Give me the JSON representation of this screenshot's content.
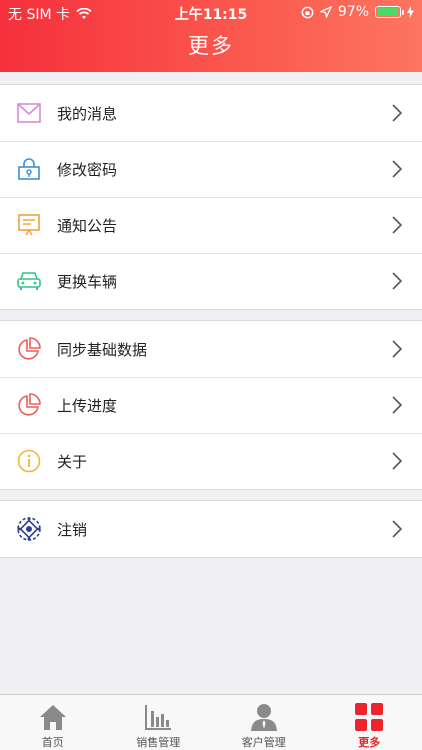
{
  "status_bar": {
    "carrier": "无 SIM 卡",
    "time": "上午11:15",
    "battery_percent": "97%",
    "battery_level": 0.97
  },
  "header": {
    "title": "更多"
  },
  "groups": [
    [
      {
        "label": "我的消息",
        "icon": "mail-icon",
        "color": "#d98ad6"
      },
      {
        "label": "修改密码",
        "icon": "lock-icon",
        "color": "#3f8fd3"
      },
      {
        "label": "通知公告",
        "icon": "notice-board-icon",
        "color": "#f0a23a"
      },
      {
        "label": "更换车辆",
        "icon": "car-icon",
        "color": "#35c48c"
      }
    ],
    [
      {
        "label": "同步基础数据",
        "icon": "pie-chart-icon",
        "color": "#ef5b5b"
      },
      {
        "label": "上传进度",
        "icon": "pie-chart-icon",
        "color": "#ef5b5b"
      },
      {
        "label": "关于",
        "icon": "info-icon",
        "color": "#f0b83a"
      }
    ],
    [
      {
        "label": "注销",
        "icon": "logout-emblem-icon",
        "color": "#2f3f8f"
      }
    ]
  ],
  "tabbar": [
    {
      "label": "首页",
      "icon": "home-icon",
      "active": false
    },
    {
      "label": "销售管理",
      "icon": "bar-chart-icon",
      "active": false
    },
    {
      "label": "客户管理",
      "icon": "person-icon",
      "active": false
    },
    {
      "label": "更多",
      "icon": "grid-icon",
      "active": true
    }
  ],
  "colors": {
    "header_start": "#f5303c",
    "header_end": "#fd7560",
    "active_tab": "#e8262b",
    "background": "#efeff4"
  }
}
